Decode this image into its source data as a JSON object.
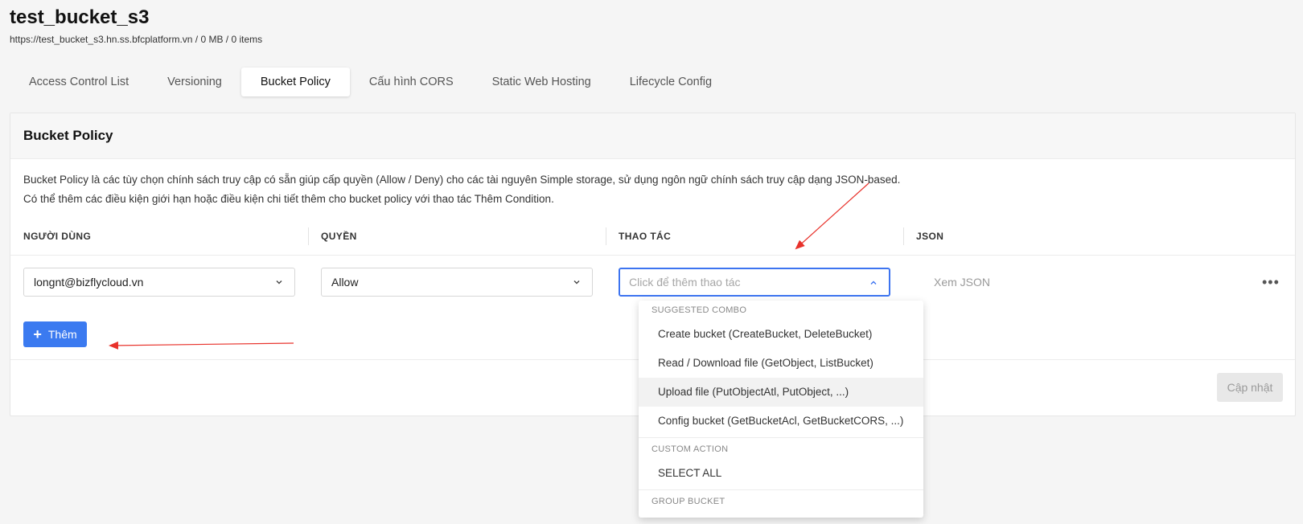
{
  "header": {
    "title": "test_bucket_s3",
    "subtitle": "https://test_bucket_s3.hn.ss.bfcplatform.vn / 0 MB / 0 items"
  },
  "tabs": [
    {
      "label": "Access Control List"
    },
    {
      "label": "Versioning"
    },
    {
      "label": "Bucket Policy",
      "active": true
    },
    {
      "label": "Cấu hình CORS"
    },
    {
      "label": "Static Web Hosting"
    },
    {
      "label": "Lifecycle Config"
    }
  ],
  "card": {
    "title": "Bucket Policy",
    "description_1": "Bucket Policy là các tùy chọn chính sách truy cập có sẵn giúp cấp quyền (Allow / Deny) cho các tài nguyên Simple storage, sử dụng ngôn ngữ chính sách truy cập dạng JSON-based.",
    "description_2": "Có thể thêm các điều kiện giới hạn hoặc điều kiện chi tiết thêm cho bucket policy với thao tác Thêm Condition."
  },
  "columns": {
    "user": "NGƯỜI DÙNG",
    "permission": "QUYỀN",
    "action": "THAO TÁC",
    "json": "JSON"
  },
  "row": {
    "user_value": "longnt@bizflycloud.vn",
    "permission_value": "Allow",
    "action_placeholder": "Click để thêm thao tác",
    "json_link": "Xem JSON",
    "more_icon": "ellipsis-icon"
  },
  "buttons": {
    "add_label": "Thêm",
    "update_label": "Cập nhật"
  },
  "dropdown": {
    "group_1": "SUGGESTED COMBO",
    "items_1": [
      "Create bucket (CreateBucket, DeleteBucket)",
      "Read / Download file (GetObject, ListBucket)",
      "Upload file (PutObjectAtl, PutObject, ...)",
      "Config bucket (GetBucketAcl, GetBucketCORS, ...)"
    ],
    "group_2": "CUSTOM ACTION",
    "items_2": [
      "SELECT ALL"
    ],
    "group_3": "GROUP BUCKET"
  },
  "colors": {
    "primary": "#3b7af0",
    "annotation_arrow": "#e8322b"
  }
}
